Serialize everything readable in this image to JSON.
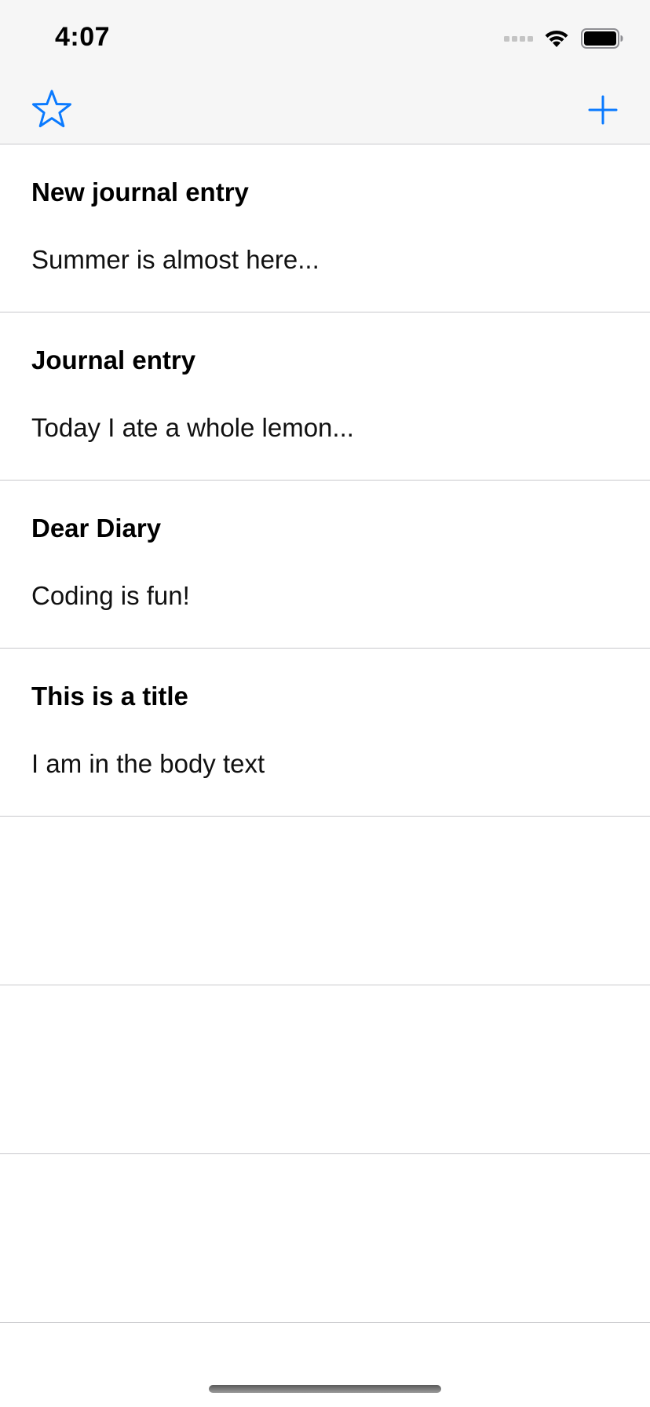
{
  "status_bar": {
    "time": "4:07",
    "icons": [
      "signal-icon",
      "wifi-icon",
      "battery-icon"
    ]
  },
  "nav_bar": {
    "left_icon": "star-icon",
    "right_icon": "plus-icon",
    "accent_color": "#0a7aff"
  },
  "entries": [
    {
      "title": "New journal entry",
      "body": "Summer is almost here..."
    },
    {
      "title": "Journal entry",
      "body": "Today I ate a whole lemon..."
    },
    {
      "title": "Dear Diary",
      "body": "Coding is fun!"
    },
    {
      "title": "This is a title",
      "body": "I am in the body text"
    }
  ]
}
